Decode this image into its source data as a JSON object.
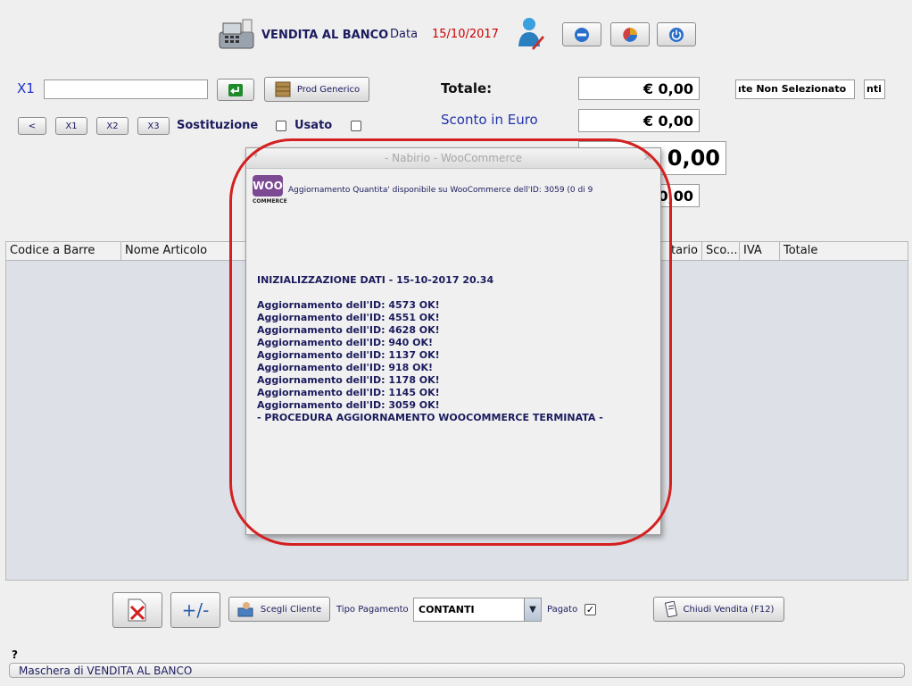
{
  "header": {
    "title": "VENDITA AL BANCO",
    "date_label": "Data",
    "date_value": "15/10/2017",
    "colors": {
      "date": "#cc0000",
      "title": "#1b1b5e"
    },
    "icons": [
      "cash-register-icon",
      "user-icon",
      "minimize-icon",
      "pie-chart-icon",
      "power-icon"
    ]
  },
  "entry": {
    "qty_label": "X1",
    "barcode_value": "",
    "prod_generico_label": "Prod Generico",
    "multiplier_buttons": [
      "<",
      "X1",
      "X2",
      "X3"
    ],
    "sostituzione_label": "Sostituzione",
    "usato_label": "Usato"
  },
  "totals": {
    "totale_label": "Totale:",
    "totale_value": "€ 0,00",
    "sconto_label": "Sconto in Euro",
    "sconto_value": "€ 0,00",
    "big_value": "0,00",
    "small_value": "0,00",
    "client_field": "ıte Non Selezionato",
    "client_field_2": "nti"
  },
  "table": {
    "columns": [
      "Codice a Barre",
      "Nome Articolo",
      "tario",
      "Sco...",
      "IVA",
      "Totale"
    ]
  },
  "dialog": {
    "title": "- Nabirio - WooCommerce",
    "logo_text": "WOO",
    "logo_sub": "COMMERCE",
    "status_text": "Aggiornamento Quantita' disponibile su WooCommerce dell'ID: 3059 (0 di 9",
    "log_header": "INIZIALIZZAZIONE DATI - 15-10-2017 20.34",
    "log_lines": [
      "Aggiornamento dell'ID: 4573 OK!",
      "Aggiornamento dell'ID: 4551 OK!",
      "Aggiornamento dell'ID: 4628 OK!",
      "Aggiornamento dell'ID: 940 OK!",
      "Aggiornamento dell'ID: 1137 OK!",
      "Aggiornamento dell'ID: 918 OK!",
      "Aggiornamento dell'ID: 1178 OK!",
      "Aggiornamento dell'ID: 1145 OK!",
      "Aggiornamento dell'ID: 3059 OK!"
    ],
    "log_footer": "- PROCEDURA AGGIORNAMENTO WOOCOMMERCE TERMINATA -",
    "colors": {
      "annotation": "#d42020",
      "logo": "#7b4a93"
    }
  },
  "bottom": {
    "plus_minus_label": "+/-",
    "scegli_cliente_label": "Scegli Cliente",
    "tipo_pagamento_label": "Tipo Pagamento",
    "tipo_pagamento_value": "CONTANTI",
    "pagato_label": "Pagato",
    "pagato_checked": "✓",
    "chiudi_vendita_label": "Chiudi Vendita (F12)"
  },
  "status": {
    "help": "?",
    "message": "Maschera di VENDITA AL BANCO"
  }
}
